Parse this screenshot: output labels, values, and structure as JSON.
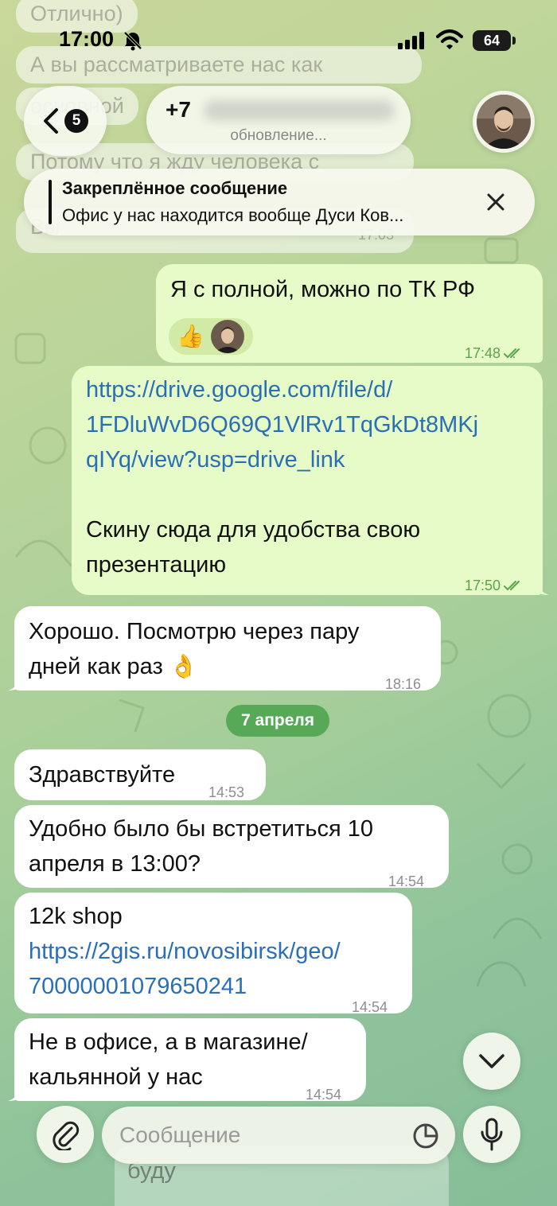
{
  "status_bar": {
    "time": "17:00",
    "battery": "64",
    "bell_icon": "bell-slash-icon",
    "signal_icon": "cellular-signal-icon",
    "wifi_icon": "wifi-icon"
  },
  "background_text": {
    "lines": [
      "Отлично)",
      "А вы рассматриваете нас как",
      "основной",
      "Потому что я жду человека с",
      "Вы"
    ],
    "time": "17:03"
  },
  "header": {
    "back_count": "5",
    "contact_name": "+7",
    "status": "обновление...",
    "back_icon": "chevron-left-icon"
  },
  "pinned": {
    "title": "Закреплённое сообщение",
    "text": "Офис у нас находится вообще Дуси Ков...",
    "close_icon": "close-icon"
  },
  "messages": [
    {
      "dir": "out",
      "text": "Я с полной, можно по ТК РФ",
      "reaction": "👍",
      "time": "17:48"
    },
    {
      "dir": "out",
      "lines": [
        "https://drive.google.com/file/d/",
        "1FDluWvD6Q69Q1VlRv1TqGkDt8MKj",
        "qIYq/view?usp=drive_link",
        "",
        "Скину сюда для удобства свою",
        "презентацию"
      ],
      "time": "17:50"
    },
    {
      "dir": "in",
      "lines": [
        "Хорошо. Посмотрю через пару",
        "дней как раз 👌"
      ],
      "time": "18:16"
    },
    {
      "dir": "in",
      "text": "Здравствуйте",
      "time": "14:53"
    },
    {
      "dir": "in",
      "lines": [
        "Удобно было бы встретиться 10",
        "апреля в 13:00?"
      ],
      "time": "14:54"
    },
    {
      "dir": "in",
      "lines": [
        "12k shop",
        "https://2gis.ru/novosibirsk/geo/",
        "70000001079650241"
      ],
      "time": "14:54"
    },
    {
      "dir": "in",
      "lines": [
        "Не в офисе, а в магазине/",
        "кальянной у нас"
      ],
      "time": "14:54"
    }
  ],
  "date_separator": "7 апреля",
  "below_input_text": "буду",
  "input": {
    "placeholder": "Сообщение",
    "attach_icon": "paperclip-icon",
    "sticker_icon": "sticker-icon",
    "mic_icon": "microphone-icon"
  },
  "scroll_down_icon": "chevron-down-icon",
  "colors": {
    "outgoing": "#e6fbc8",
    "incoming": "#ffffff",
    "check": "#5da34d",
    "link": "#2a6fb6",
    "date_pill": "#58a957"
  }
}
